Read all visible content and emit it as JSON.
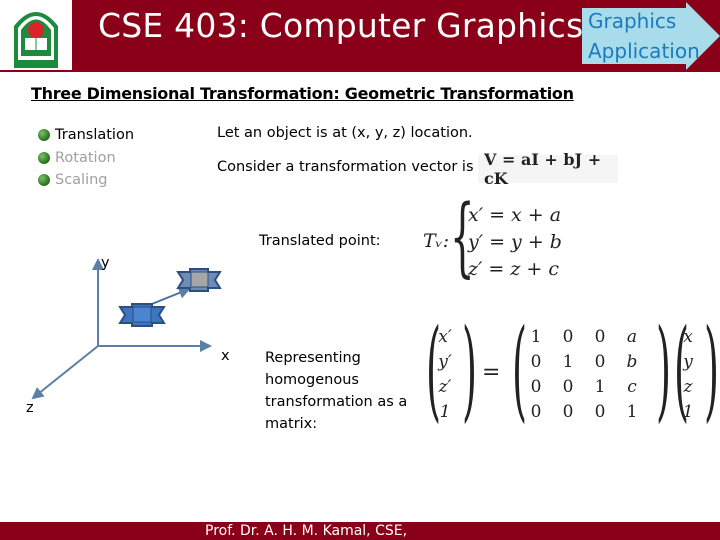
{
  "header": {
    "title": "CSE 403: Computer Graphics",
    "tag_line1": "Graphics",
    "tag_line2": "Application",
    "logo": "university-crest-logo"
  },
  "slide": {
    "subtitle": "Three Dimensional Transformation: Geometric Transformation",
    "bullets": [
      {
        "label": "Translation",
        "state": "active"
      },
      {
        "label": "Rotation",
        "state": "dim"
      },
      {
        "label": "Scaling",
        "state": "dim"
      }
    ],
    "line1": "Let an object is at (x, y, z) location.",
    "line2": "Consider a transformation vector is",
    "vector_formula": "V = aI + bJ + cK",
    "translated_label": "Translated point:",
    "tv_symbol": "Tᵥ:",
    "equations": [
      "x′ = x + a",
      "y′ = y + b",
      "z′ = z + c"
    ],
    "matrix_caption": "Representing homogenous transformation as a matrix:",
    "axis_labels": {
      "x": "x",
      "y": "y",
      "z": "z"
    },
    "matrix": {
      "lhs": [
        "x′",
        "y′",
        "z′",
        "1"
      ],
      "transform": [
        [
          "1",
          "0",
          "0",
          "a"
        ],
        [
          "0",
          "1",
          "0",
          "b"
        ],
        [
          "0",
          "0",
          "1",
          "c"
        ],
        [
          "0",
          "0",
          "0",
          "1"
        ]
      ],
      "rhs": [
        "x",
        "y",
        "z",
        "1"
      ],
      "equals": "="
    }
  },
  "footer": {
    "text": "Prof. Dr. A. H. M. Kamal, CSE,"
  },
  "colors": {
    "brand": "#8b0019",
    "tag_fill": "#a9dcea",
    "tag_text": "#1a7bbf",
    "axis": "#5b7fa6",
    "object_fill": "#3c74c0",
    "object_border": "#2c4f82",
    "object_moved_fill": "#a6a6a6"
  }
}
